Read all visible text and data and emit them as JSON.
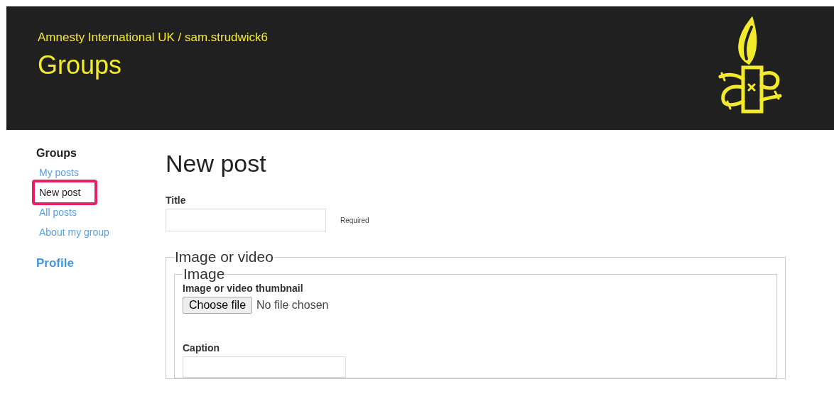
{
  "header": {
    "breadcrumb": "Amnesty International UK / sam.strudwick6",
    "title": "Groups"
  },
  "sidebar": {
    "heading": "Groups",
    "items": [
      {
        "label": "My posts",
        "selected": false
      },
      {
        "label": "New post",
        "selected": true
      },
      {
        "label": "All posts",
        "selected": false
      },
      {
        "label": "About my group",
        "selected": false
      }
    ],
    "profile": "Profile"
  },
  "main": {
    "heading": "New post",
    "title_field": {
      "label": "Title",
      "hint": "Required"
    },
    "fieldset": {
      "legend": "Image or video",
      "inner": {
        "legend": "Image",
        "thumbnail_label": "Image or video thumbnail",
        "file_button": "Choose file",
        "file_status": "No file chosen",
        "caption_label": "Caption"
      }
    }
  }
}
